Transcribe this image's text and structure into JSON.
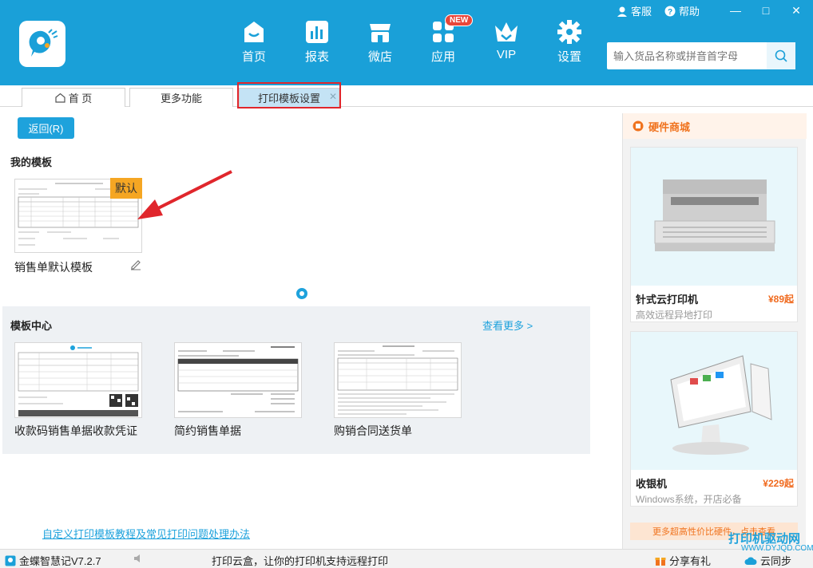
{
  "header": {
    "nav": [
      {
        "label": "首页",
        "icon": "home-icon"
      },
      {
        "label": "报表",
        "icon": "chart-icon"
      },
      {
        "label": "微店",
        "icon": "shop-icon"
      },
      {
        "label": "应用",
        "icon": "apps-icon",
        "badge": "NEW"
      },
      {
        "label": "VIP",
        "icon": "crown-icon"
      },
      {
        "label": "设置",
        "icon": "gear-icon"
      }
    ],
    "service": "客服",
    "help": "帮助",
    "search_placeholder": "输入货品名称或拼音首字母"
  },
  "tabs": [
    {
      "label": "首 页"
    },
    {
      "label": "更多功能"
    },
    {
      "label": "打印模板设置",
      "active": true
    }
  ],
  "main": {
    "back_label": "返回(R)",
    "my_templates_title": "我的模板",
    "default_tag": "默认",
    "my_templates": [
      {
        "name": "销售单默认模板"
      }
    ],
    "center_title": "模板中心",
    "see_more": "查看更多 >",
    "center_templates": [
      {
        "name": "收款码销售单据收款凭证"
      },
      {
        "name": "简约销售单据"
      },
      {
        "name": "购销合同送货单"
      }
    ],
    "tutorial_link": "自定义打印模板教程及常见打印问题处理办法"
  },
  "sidebar": {
    "title": "硬件商城",
    "products": [
      {
        "name": "针式云打印机",
        "price": "¥89起",
        "desc": "高效远程异地打印"
      },
      {
        "name": "收银机",
        "price": "¥229起",
        "desc": "Windows系统，开店必备"
      }
    ],
    "more_label": "更多超高性价比硬件，点击查看"
  },
  "statusbar": {
    "app_name": "金蝶智慧记V7.2.7",
    "message": "打印云盒，让你的打印机支持远程打印",
    "share": "分享有礼",
    "sync": "云同步"
  },
  "watermark": {
    "title": "打印机驱动网",
    "url": "WWW.DYJQD.COM"
  },
  "colors": {
    "header_bg": "#1aa0d8",
    "accent": "#1ea2dc",
    "highlight_border": "#e0262c",
    "price": "#f06a1e",
    "default_tag": "#f5a623"
  }
}
